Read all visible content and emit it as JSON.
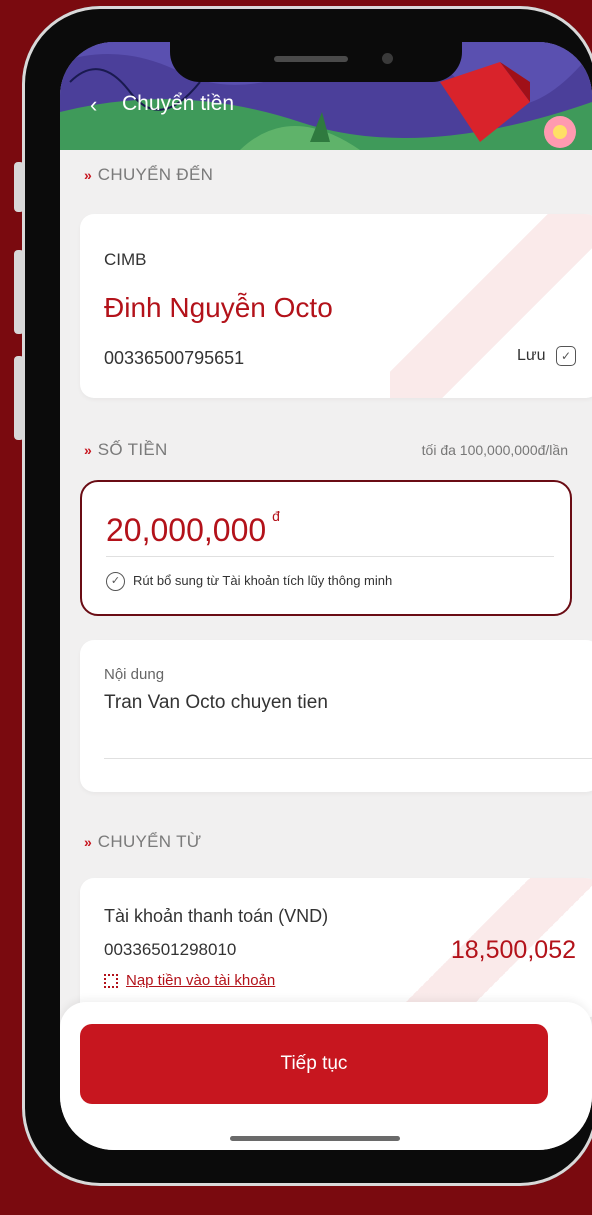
{
  "header": {
    "title": "Chuyển tiền",
    "back_icon": "chevron-left-icon"
  },
  "sections": {
    "to_label": "CHUYỂN ĐẾN",
    "amount_label": "SỐ TIỀN",
    "amount_limit": "tối đa 100,000,000đ/lần",
    "from_label": "CHUYỂN TỪ"
  },
  "recipient": {
    "bank": "CIMB",
    "name": "Đinh Nguyễn Octo",
    "account": "00336500795651",
    "save_label": "Lưu"
  },
  "amount": {
    "value": "20,000,000",
    "unit": "đ",
    "topup_label": "Rút bổ sung từ Tài khoản tích lũy thông minh"
  },
  "content": {
    "label": "Nội dung",
    "value": "Tran Van Octo chuyen tien"
  },
  "source": {
    "name": "Tài khoản thanh toán (VND)",
    "account": "00336501298010",
    "balance": "18,500,052",
    "topup_link": "Nạp tiền vào tài khoản"
  },
  "footer": {
    "continue_label": "Tiếp tục"
  },
  "colors": {
    "brand_red": "#c7161f",
    "background": "#7a0a0f",
    "amount_border": "#6a0c14"
  }
}
